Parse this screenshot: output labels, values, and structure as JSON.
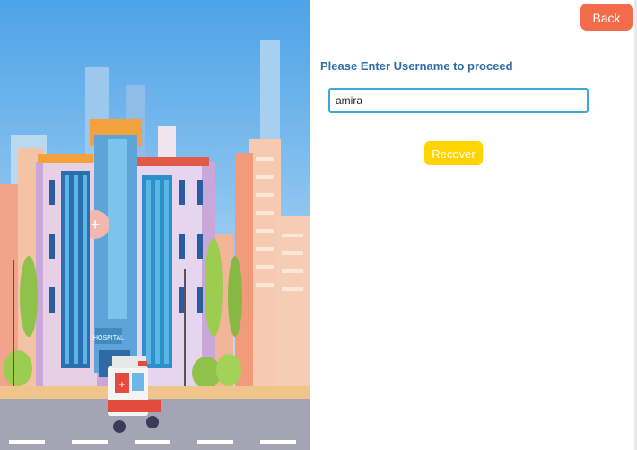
{
  "header": {
    "back_label": "Back"
  },
  "form": {
    "heading": "Please Enter Username to proceed",
    "username_value": "amira",
    "recover_label": "Recover"
  },
  "hero": {
    "illustration": "hospital-building-with-ambulance",
    "sign_text": "HOSPITAL"
  },
  "colors": {
    "back_button": "#f26b4a",
    "recover_button": "#ffd400",
    "heading": "#2f6ea8",
    "input_border": "#3aa9d6"
  }
}
